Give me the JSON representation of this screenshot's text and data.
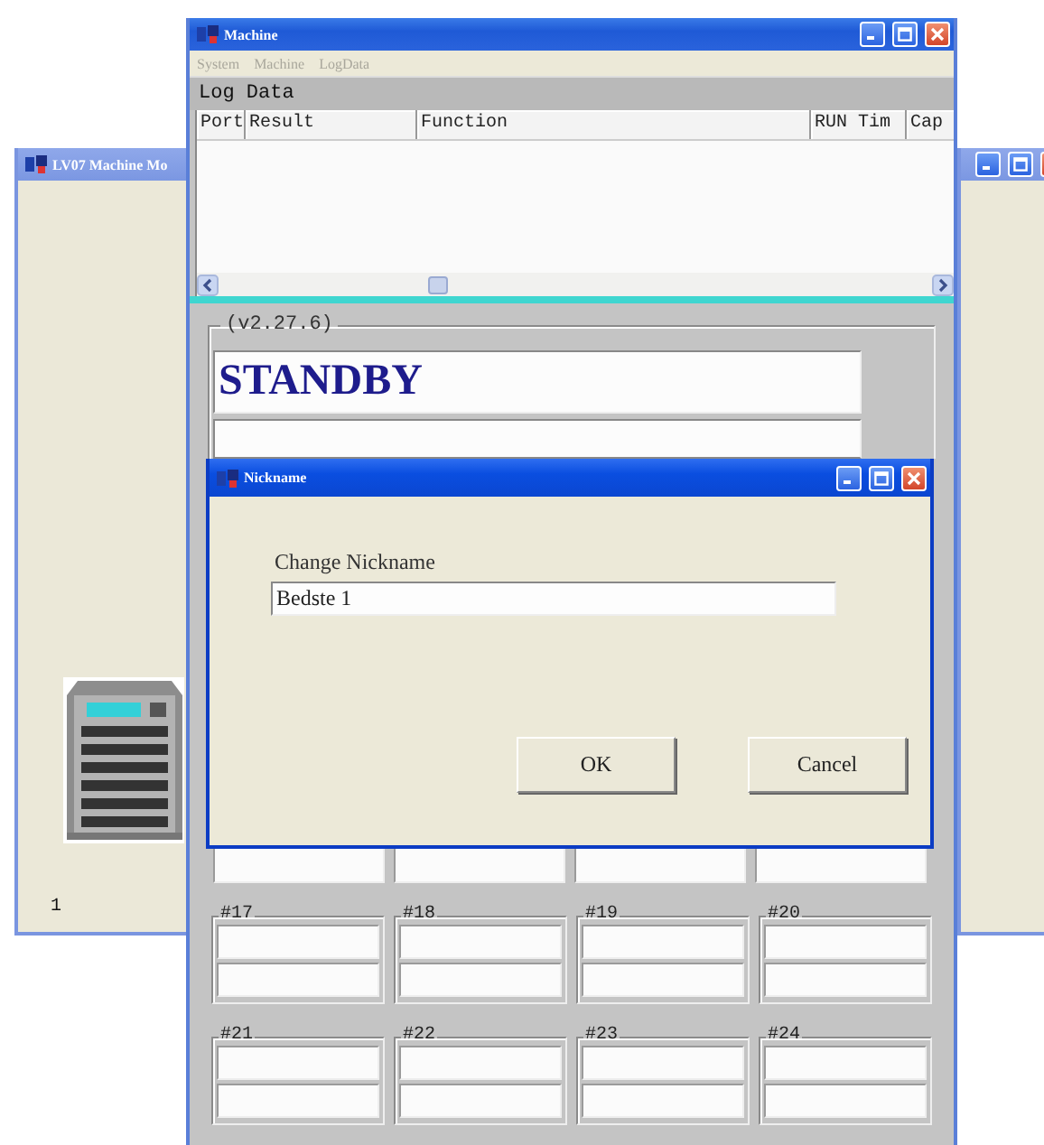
{
  "background_window": {
    "title": "LV07 Machine Mo",
    "port_label": "1"
  },
  "machine_window": {
    "title": "Machine",
    "menu": [
      {
        "label": "System",
        "disabled": true
      },
      {
        "label": "Machine",
        "disabled": true
      },
      {
        "label": "LogData",
        "disabled": true
      }
    ],
    "log_data": {
      "title": "Log Data",
      "columns": [
        "Port",
        "Result",
        "Function",
        "RUN Tim",
        "Cap"
      ]
    },
    "version": "(v2.27.6)",
    "status": "STANDBY",
    "slots": [
      {
        "label": "#17"
      },
      {
        "label": "#18"
      },
      {
        "label": "#19"
      },
      {
        "label": "#20"
      },
      {
        "label": "#21"
      },
      {
        "label": "#22"
      },
      {
        "label": "#23"
      },
      {
        "label": "#24"
      }
    ]
  },
  "dialog": {
    "title": "Nickname",
    "field_label": "Change Nickname",
    "value": "Bedste 1",
    "buttons": [
      "OK",
      "Cancel"
    ]
  }
}
